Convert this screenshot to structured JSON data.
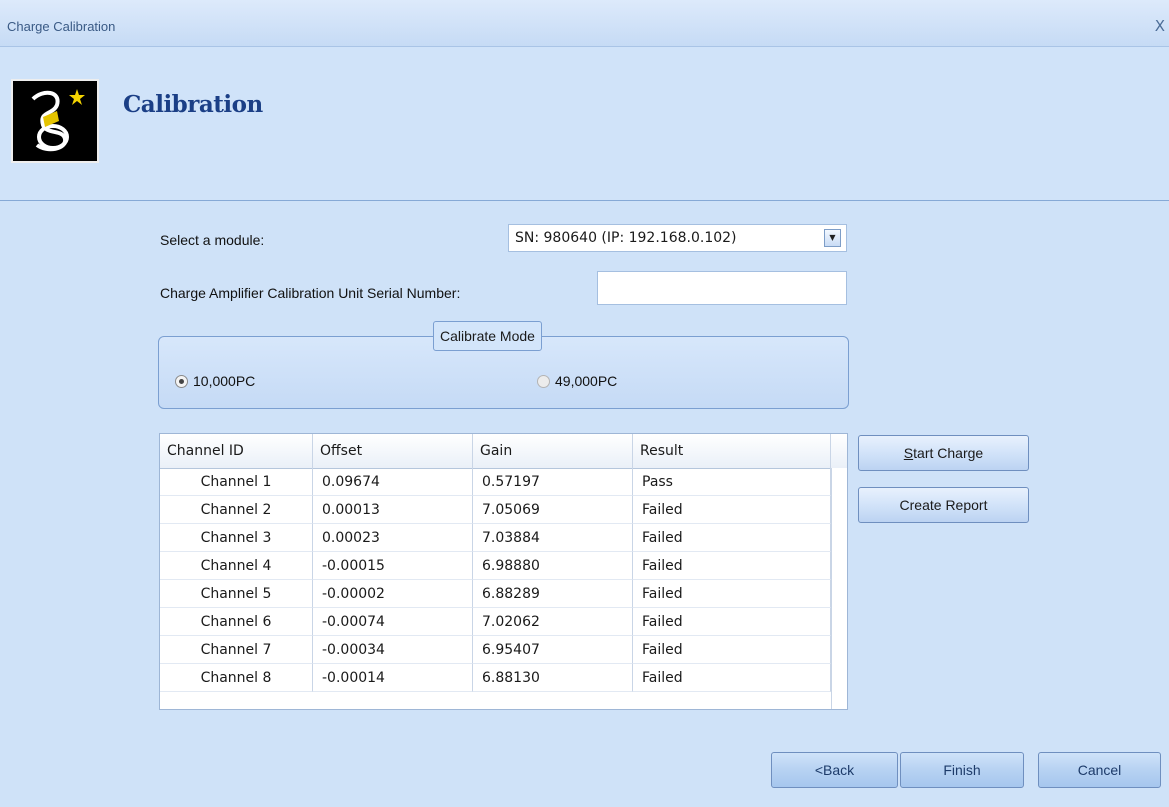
{
  "window": {
    "title": "Charge Calibration",
    "close_glyph": "X"
  },
  "header": {
    "title": "Calibration",
    "logo_icon": "wizard-icon"
  },
  "form": {
    "module_label": "Select a module:",
    "module_value": "SN: 980640 (IP: 192.168.0.102)",
    "serial_label": "Charge Amplifier Calibration Unit Serial Number:",
    "serial_value": ""
  },
  "calibrate_mode": {
    "title": "Calibrate Mode",
    "options": [
      {
        "label": "10,000PC",
        "checked": true,
        "enabled": true
      },
      {
        "label": "49,000PC",
        "checked": false,
        "enabled": false
      }
    ]
  },
  "grid": {
    "columns": [
      "Channel ID",
      "Offset",
      "Gain",
      "Result"
    ],
    "rows": [
      [
        "Channel 1",
        "0.09674",
        "0.57197",
        "Pass"
      ],
      [
        "Channel 2",
        "0.00013",
        "7.05069",
        "Failed"
      ],
      [
        "Channel 3",
        "0.00023",
        "7.03884",
        "Failed"
      ],
      [
        "Channel 4",
        "-0.00015",
        "6.98880",
        "Failed"
      ],
      [
        "Channel 5",
        "-0.00002",
        "6.88289",
        "Failed"
      ],
      [
        "Channel 6",
        "-0.00074",
        "7.02062",
        "Failed"
      ],
      [
        "Channel 7",
        "-0.00034",
        "6.95407",
        "Failed"
      ],
      [
        "Channel 8",
        "-0.00014",
        "6.88130",
        "Failed"
      ]
    ]
  },
  "side_buttons": {
    "start_charge_first": "S",
    "start_charge_rest": "tart Charge",
    "create_report": "Create Report"
  },
  "footer": {
    "back": "<Back",
    "finish": "Finish",
    "cancel": "Cancel"
  }
}
